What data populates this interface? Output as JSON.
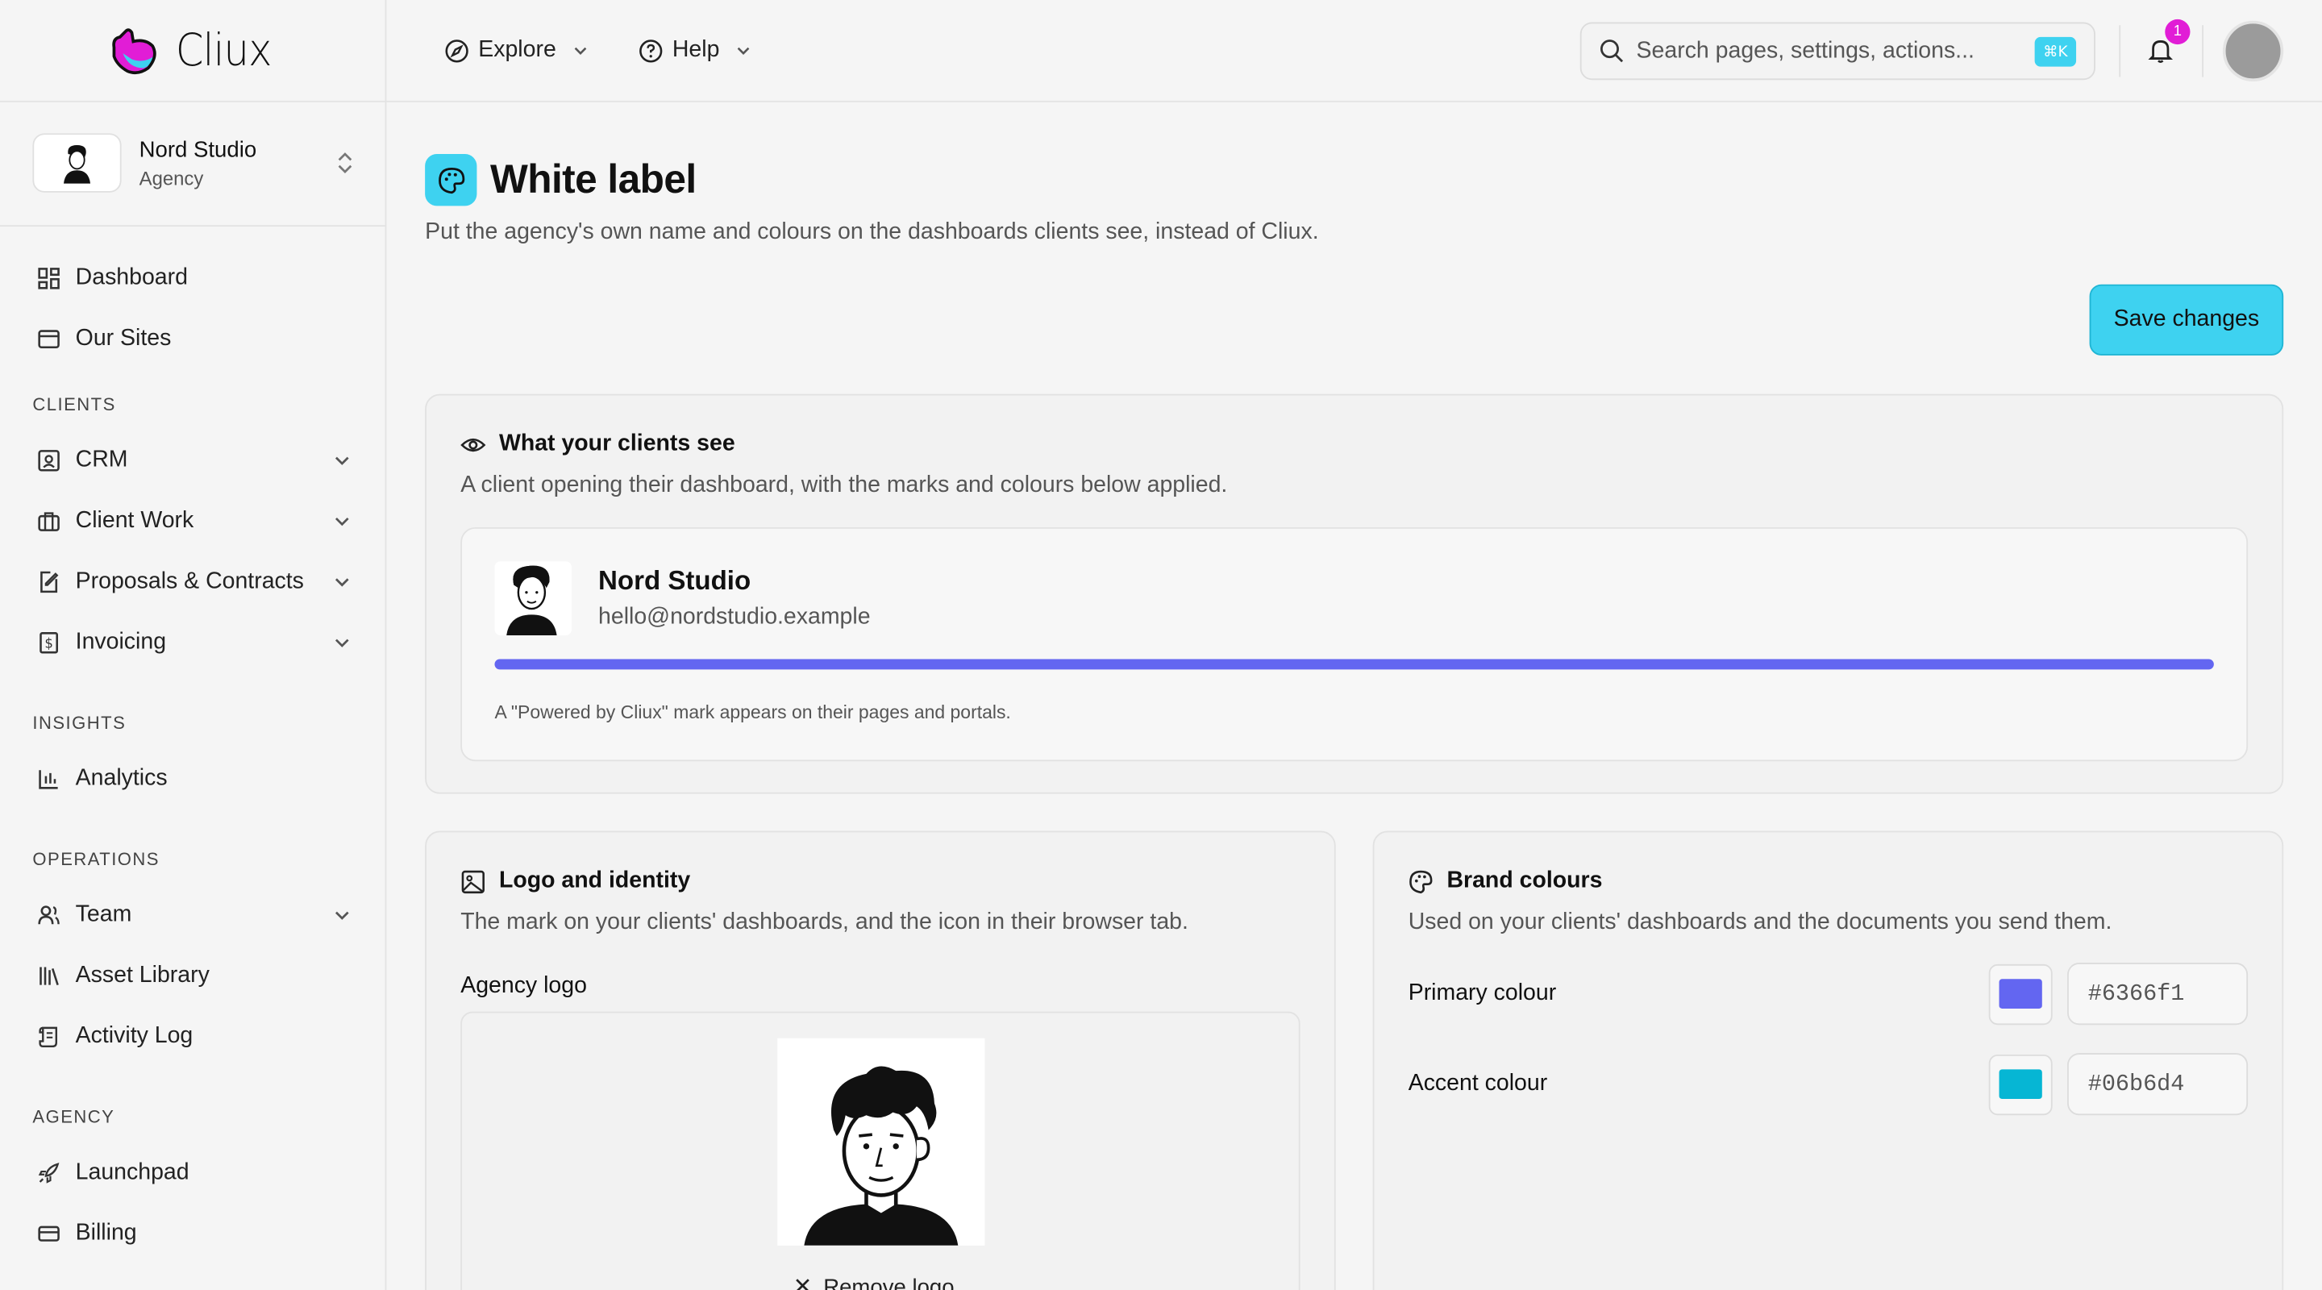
{
  "brand": {
    "name": "Cliux"
  },
  "workspace": {
    "name": "Nord Studio",
    "type": "Agency"
  },
  "sidebar": {
    "top_items": [
      {
        "label": "Dashboard",
        "icon": "dashboard-icon"
      },
      {
        "label": "Our Sites",
        "icon": "browser-icon"
      }
    ],
    "sections": [
      {
        "title": "CLIENTS",
        "items": [
          {
            "label": "CRM",
            "icon": "contact-card-icon",
            "expandable": true
          },
          {
            "label": "Client Work",
            "icon": "briefcase-icon",
            "expandable": true
          },
          {
            "label": "Proposals & Contracts",
            "icon": "document-edit-icon",
            "expandable": true
          },
          {
            "label": "Invoicing",
            "icon": "invoice-icon",
            "expandable": true
          }
        ]
      },
      {
        "title": "INSIGHTS",
        "items": [
          {
            "label": "Analytics",
            "icon": "bar-chart-icon"
          }
        ]
      },
      {
        "title": "OPERATIONS",
        "items": [
          {
            "label": "Team",
            "icon": "users-icon",
            "expandable": true
          },
          {
            "label": "Asset Library",
            "icon": "library-icon"
          },
          {
            "label": "Activity Log",
            "icon": "scroll-icon"
          }
        ]
      },
      {
        "title": "AGENCY",
        "items": [
          {
            "label": "Launchpad",
            "icon": "rocket-icon"
          },
          {
            "label": "Billing",
            "icon": "credit-card-icon"
          }
        ]
      }
    ]
  },
  "topbar": {
    "explore_label": "Explore",
    "help_label": "Help",
    "search_placeholder": "Search pages, settings, actions...",
    "search_shortcut": "⌘K",
    "notification_count": "1"
  },
  "page": {
    "title": "White label",
    "subtitle": "Put the agency's own name and colours on the dashboards clients see, instead of Cliux.",
    "save_label": "Save changes"
  },
  "preview": {
    "title": "What your clients see",
    "description": "A client opening their dashboard, with the marks and colours below applied.",
    "client_name": "Nord Studio",
    "client_email": "hello@nordstudio.example",
    "note": "A \"Powered by Cliux\" mark appears on their pages and portals."
  },
  "logo_section": {
    "title": "Logo and identity",
    "description": "The mark on your clients' dashboards, and the icon in their browser tab.",
    "logo_label": "Agency logo",
    "remove_label": "Remove logo"
  },
  "colours_section": {
    "title": "Brand colours",
    "description": "Used on your clients' dashboards and the documents you send them.",
    "primary_label": "Primary colour",
    "primary_value": "#6366f1",
    "accent_label": "Accent colour",
    "accent_value": "#06b6d4"
  },
  "colors": {
    "accent": "#3ed2f0",
    "badge": "#e11dd6",
    "primary": "#6366f1",
    "secondary": "#06b6d4"
  }
}
